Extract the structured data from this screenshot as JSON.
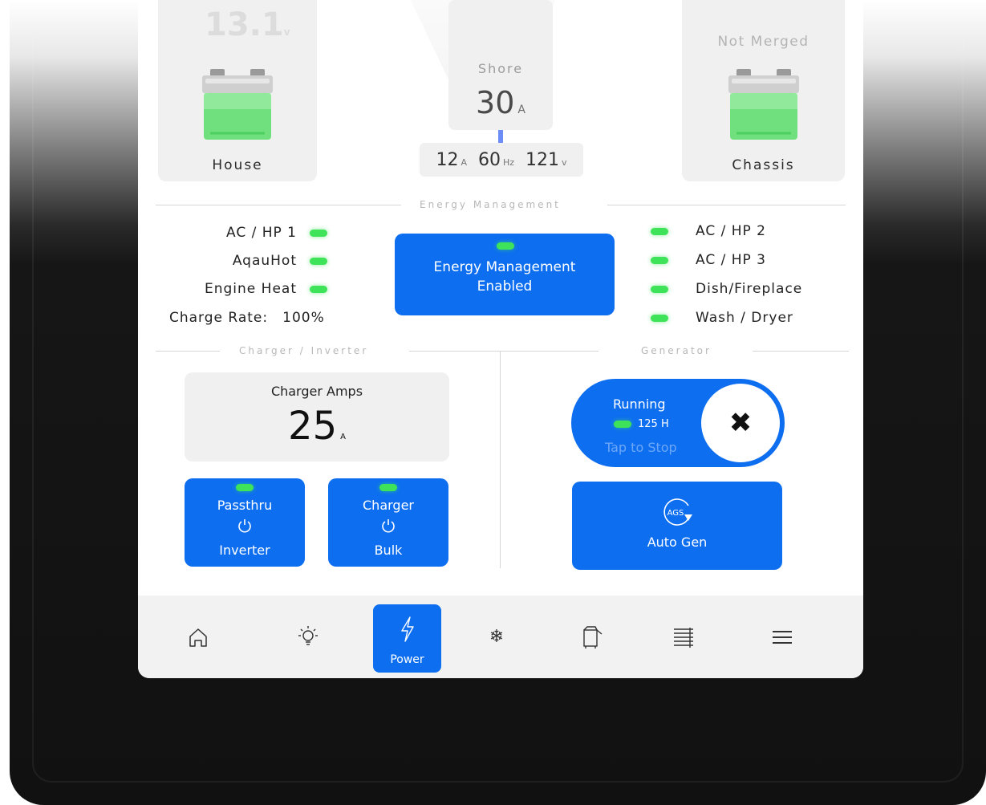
{
  "top": {
    "house": {
      "voltage": "13.1",
      "voltage_unit": "v",
      "label": "House"
    },
    "shore": {
      "title": "Shore",
      "amps": "30",
      "amps_unit": "A",
      "readings": [
        {
          "value": "12",
          "unit": "A"
        },
        {
          "value": "60",
          "unit": "Hz"
        },
        {
          "value": "121",
          "unit": "v"
        }
      ]
    },
    "chassis": {
      "status": "Not Merged",
      "label": "Chassis"
    }
  },
  "energy_management": {
    "section_title": "Energy Management",
    "left_loads": [
      "AC / HP 1",
      "AqauHot",
      "Engine Heat"
    ],
    "charge_rate_label": "Charge Rate:",
    "charge_rate_value": "100%",
    "button_line1": "Energy Management",
    "button_line2": "Enabled",
    "right_loads": [
      "AC / HP 2",
      "AC / HP 3",
      "Dish/Fireplace",
      "Wash / Dryer"
    ],
    "led_color": "#3fe35a"
  },
  "charger_inverter": {
    "section_title": "Charger / Inverter",
    "amps_title": "Charger Amps",
    "amps_value": "25",
    "amps_unit": "A",
    "inverter_button": {
      "top": "Passthru",
      "bottom": "Inverter",
      "icon": "power-icon"
    },
    "charger_button": {
      "top": "Charger",
      "bottom": "Bulk",
      "icon": "power-icon"
    }
  },
  "generator": {
    "section_title": "Generator",
    "state": "Running",
    "hours": "125 H",
    "hint": "Tap to Stop",
    "stop_icon": "close-icon",
    "autogen_icon_text": "AGS",
    "autogen_label": "Auto Gen"
  },
  "nav": {
    "active_label": "Power",
    "items": [
      "home-icon",
      "light-bulb-icon",
      "power-bolt-icon",
      "snowflake-icon",
      "slideout-icon",
      "shades-icon",
      "menu-icon"
    ]
  },
  "colors": {
    "accent": "#0d6ef0",
    "panel": "#f0f0f0",
    "led_green": "#3fe35a"
  }
}
